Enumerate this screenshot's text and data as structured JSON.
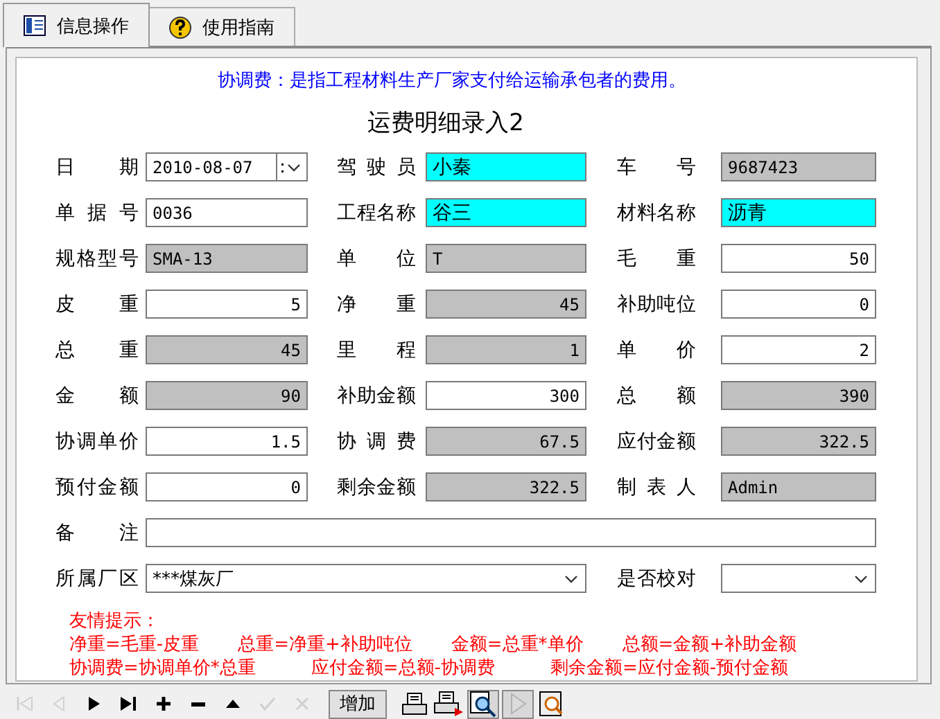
{
  "tabs": [
    {
      "label": "信息操作",
      "selected": true
    },
    {
      "label": "使用指南",
      "selected": false
    }
  ],
  "note": "协调费：是指工程材料生产厂家支付给运输承包者的费用。",
  "title": "运费明细录入2",
  "fields": [
    {
      "label": "日期",
      "value": "2010-08-07",
      "kind": "date",
      "readonly": false,
      "highlighted": false
    },
    {
      "label": "驾驶员",
      "value": "小秦",
      "kind": "text",
      "readonly": false,
      "highlighted": true
    },
    {
      "label": "车号",
      "value": "9687423",
      "kind": "text",
      "readonly": true,
      "highlighted": false
    },
    {
      "label": "单据号",
      "value": "0036",
      "kind": "text",
      "readonly": false,
      "highlighted": false
    },
    {
      "label": "工程名称",
      "value": "谷三",
      "kind": "text",
      "readonly": false,
      "highlighted": true
    },
    {
      "label": "材料名称",
      "value": "沥青",
      "kind": "text",
      "readonly": false,
      "highlighted": true
    },
    {
      "label": "规格型号",
      "value": "SMA-13",
      "kind": "text",
      "readonly": true,
      "highlighted": false
    },
    {
      "label": "单位",
      "value": "T",
      "kind": "text",
      "readonly": true,
      "highlighted": false
    },
    {
      "label": "毛重",
      "value": "50",
      "kind": "number",
      "readonly": false,
      "highlighted": false
    },
    {
      "label": "皮重",
      "value": "5",
      "kind": "number",
      "readonly": false,
      "highlighted": false
    },
    {
      "label": "净重",
      "value": "45",
      "kind": "number",
      "readonly": true,
      "highlighted": false
    },
    {
      "label": "补助吨位",
      "value": "0",
      "kind": "number",
      "readonly": false,
      "highlighted": false
    },
    {
      "label": "总重",
      "value": "45",
      "kind": "number",
      "readonly": true,
      "highlighted": false
    },
    {
      "label": "里程",
      "value": "1",
      "kind": "number",
      "readonly": true,
      "highlighted": false
    },
    {
      "label": "单价",
      "value": "2",
      "kind": "number",
      "readonly": false,
      "highlighted": false
    },
    {
      "label": "金额",
      "value": "90",
      "kind": "number",
      "readonly": true,
      "highlighted": false
    },
    {
      "label": "补助金额",
      "value": "300",
      "kind": "number",
      "readonly": false,
      "highlighted": false
    },
    {
      "label": "总额",
      "value": "390",
      "kind": "number",
      "readonly": true,
      "highlighted": false
    },
    {
      "label": "协调单价",
      "value": "1.5",
      "kind": "number",
      "readonly": false,
      "highlighted": false
    },
    {
      "label": "协调费",
      "value": "67.5",
      "kind": "number",
      "readonly": true,
      "highlighted": false
    },
    {
      "label": "应付金额",
      "value": "322.5",
      "kind": "number",
      "readonly": true,
      "highlighted": false
    },
    {
      "label": "预付金额",
      "value": "0",
      "kind": "number",
      "readonly": false,
      "highlighted": false
    },
    {
      "label": "剩余金额",
      "value": "322.5",
      "kind": "number",
      "readonly": true,
      "highlighted": false
    },
    {
      "label": "制表人",
      "value": "Admin",
      "kind": "text",
      "readonly": true,
      "highlighted": false
    }
  ],
  "remark": {
    "label": "备注"
  },
  "plant": {
    "label": "所属厂区",
    "value": "***煤灰厂"
  },
  "checked_select": {
    "label": "是否校对"
  },
  "tips": {
    "heading": "友情提示：",
    "lines": [
      [
        "净重=毛重-皮重",
        "总重=净重+补助吨位",
        "金额=总重*单价",
        "总额=金额+补助金额"
      ],
      [
        "协调费=协调单价*总重",
        "应付金额=总额-协调费",
        "剩余金额=应付金额-预付金额"
      ]
    ]
  },
  "toolbar": [
    {
      "kind": "first",
      "disabled": true
    },
    {
      "kind": "prev",
      "disabled": true
    },
    {
      "kind": "next",
      "disabled": false
    },
    {
      "kind": "last",
      "disabled": false
    },
    {
      "kind": "add",
      "disabled": false
    },
    {
      "kind": "remove",
      "disabled": false
    },
    {
      "kind": "up",
      "disabled": false
    },
    {
      "kind": "confirm",
      "disabled": true
    },
    {
      "kind": "cancel",
      "disabled": true
    },
    {
      "kind": "text",
      "label": "增加",
      "disabled": false
    },
    {
      "kind": "print",
      "disabled": false
    },
    {
      "kind": "print-export",
      "disabled": false
    },
    {
      "kind": "preview",
      "pressed": true,
      "disabled": false
    },
    {
      "kind": "play",
      "pressed": true,
      "disabled": true
    },
    {
      "kind": "zoom",
      "disabled": false
    }
  ]
}
